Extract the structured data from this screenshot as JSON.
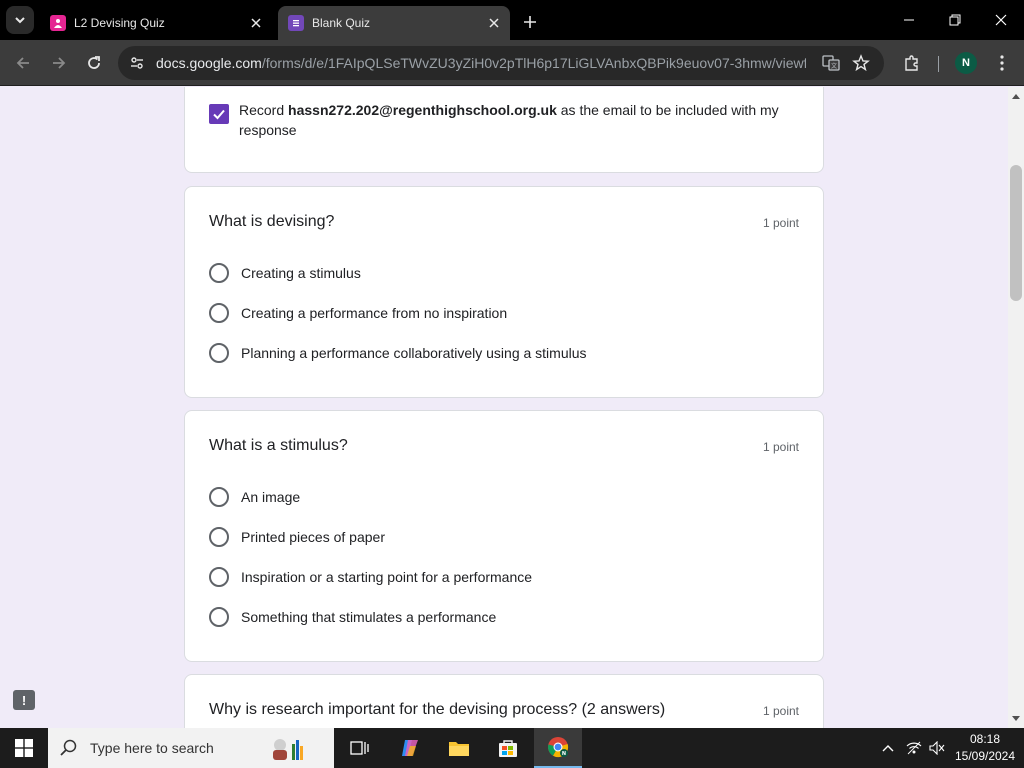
{
  "browser": {
    "tabs": [
      {
        "title": "L2 Devising Quiz",
        "favicon": "pink-person-icon",
        "active": false
      },
      {
        "title": "Blank Quiz",
        "favicon": "purple-forms-icon",
        "active": true
      }
    ],
    "url_host": "docs.google.com",
    "url_path": "/forms/d/e/1FAIpQLSeTWvZU3yZiH0v2pTlH6p17LiGLVAnbxQBPik9euov07-3hmw/viewf...",
    "profile_initial": "N"
  },
  "form": {
    "email": {
      "prefix": "Record",
      "address": "hassn272.202@regenthighschool.org.uk",
      "suffix": "as the email to be included with my response",
      "checked": true
    },
    "questions": [
      {
        "title": "What is devising?",
        "points": "1 point",
        "options": [
          "Creating a stimulus",
          "Creating a performance from no inspiration",
          "Planning a performance collaboratively using a stimulus"
        ]
      },
      {
        "title": "What is a stimulus?",
        "points": "1 point",
        "options": [
          "An image",
          "Printed pieces of paper",
          "Inspiration or a starting point for a performance",
          "Something that stimulates a performance"
        ]
      },
      {
        "title": "Why is research important for the devising process? (2 answers)",
        "points": "1 point",
        "options": []
      }
    ],
    "feedback_label": "!"
  },
  "taskbar": {
    "search_placeholder": "Type here to search",
    "time": "08:18",
    "date": "15/09/2024"
  },
  "colors": {
    "accent": "#673ab7",
    "page_bg": "#f0ebf8"
  }
}
